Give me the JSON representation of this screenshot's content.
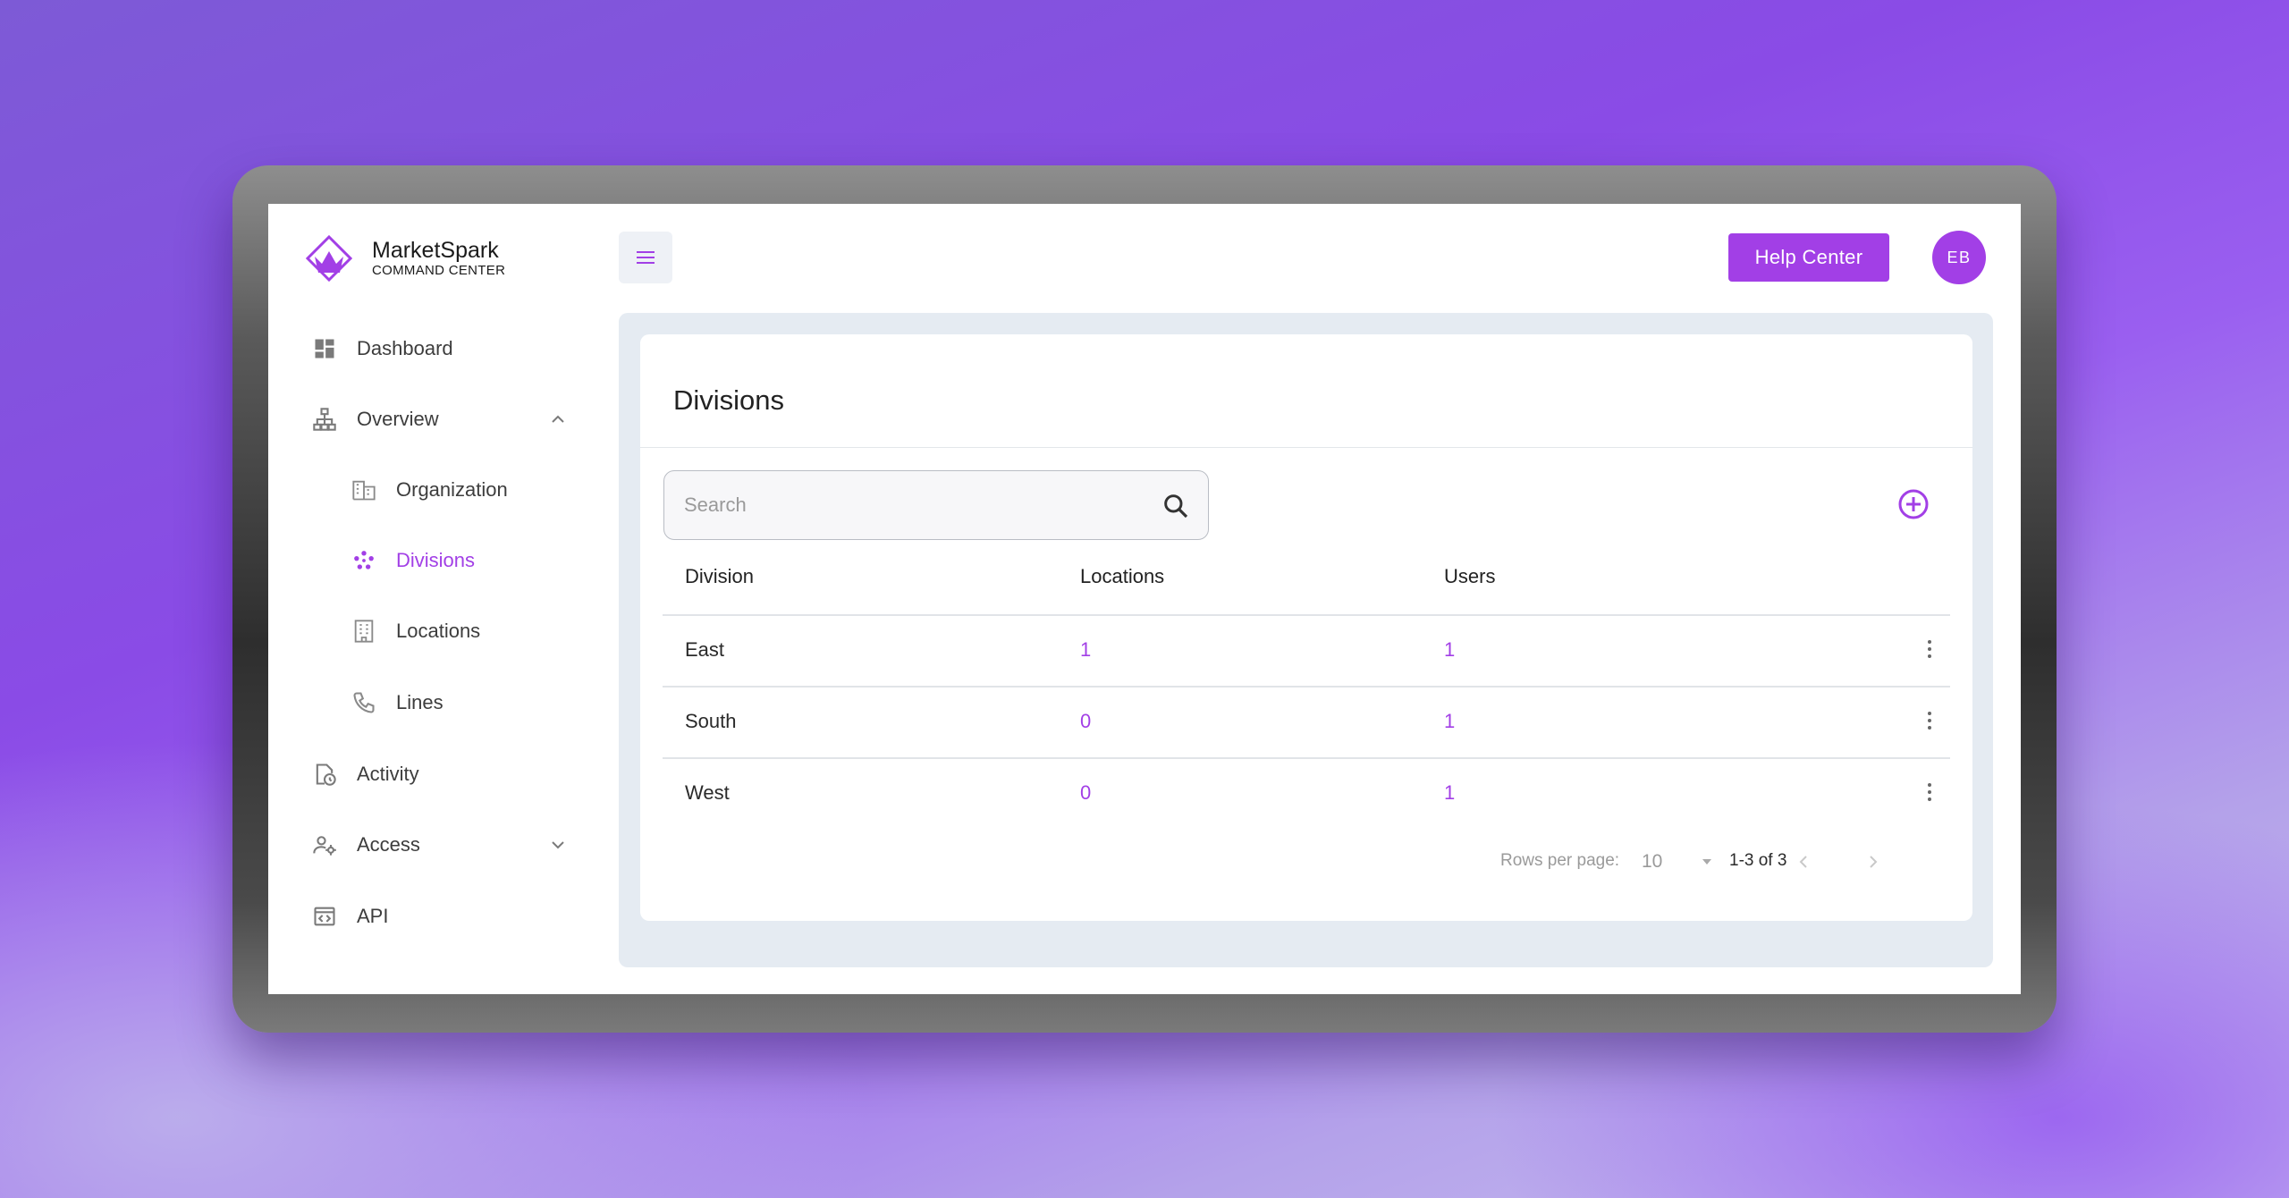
{
  "app": {
    "name": "MarketSpark",
    "subtitle": "COMMAND CENTER"
  },
  "sidebar": {
    "items": [
      {
        "label": "Dashboard",
        "icon": "dashboard-icon"
      },
      {
        "label": "Overview",
        "icon": "sitemap-icon",
        "expanded": true
      },
      {
        "label": "Organization",
        "icon": "building-icon"
      },
      {
        "label": "Divisions",
        "icon": "divisions-icon",
        "active": true
      },
      {
        "label": "Locations",
        "icon": "office-building-icon"
      },
      {
        "label": "Lines",
        "icon": "phone-icon"
      },
      {
        "label": "Activity",
        "icon": "file-clock-icon"
      },
      {
        "label": "Access",
        "icon": "users-cog-icon",
        "expanded": false
      },
      {
        "label": "API",
        "icon": "code-box-icon"
      }
    ]
  },
  "header": {
    "help_label": "Help Center",
    "avatar_initials": "EB"
  },
  "page": {
    "title": "Divisions",
    "search_placeholder": "Search"
  },
  "table": {
    "columns": [
      "Division",
      "Locations",
      "Users"
    ],
    "rows": [
      {
        "division": "East",
        "locations": "1",
        "users": "1"
      },
      {
        "division": "South",
        "locations": "0",
        "users": "1"
      },
      {
        "division": "West",
        "locations": "0",
        "users": "1"
      }
    ]
  },
  "pagination": {
    "rows_per_page_label": "Rows per page:",
    "rows_per_page_value": "10",
    "range": "1-3 of 3"
  },
  "colors": {
    "accent": "#a23fe6",
    "content_bg": "#e5ebf2"
  }
}
